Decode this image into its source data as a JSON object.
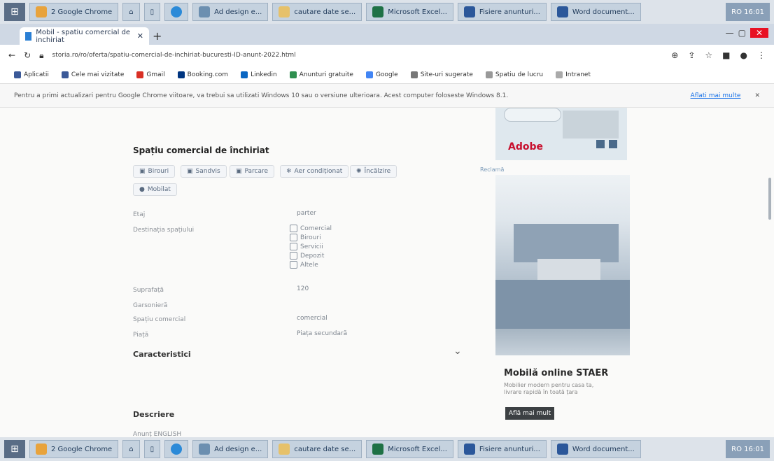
{
  "taskbar_top": {
    "start_icon": "windows-icon",
    "buttons": [
      {
        "label": "2 Google Chrome",
        "icon": "chrome-icon"
      },
      {
        "label": "",
        "icon": "home-icon"
      },
      {
        "label": "",
        "icon": "file-icon"
      },
      {
        "label": "",
        "icon": "edge-icon"
      },
      {
        "label": "Ad design e...",
        "icon": "document-icon"
      },
      {
        "label": "cautare date se...",
        "icon": "folder-icon"
      },
      {
        "label": "Microsoft Excel...",
        "icon": "excel-icon"
      },
      {
        "label": "Fisiere anunturi...",
        "icon": "word-icon"
      },
      {
        "label": "Word document...",
        "icon": "word-icon"
      }
    ],
    "tray": "RO 16:01"
  },
  "tabs": [
    {
      "label": "Mobil - spatiu comercial de inchiriat"
    }
  ],
  "address": {
    "url": "storia.ro/ro/oferta/spatiu-comercial-de-inchiriat-bucuresti-ID-anunt-2022.html"
  },
  "bookmarks": [
    "Aplicatii",
    "Cele mai vizitate",
    "Gmail",
    "Booking.com",
    "Linkedin",
    "Anunturi gratuite",
    "Google",
    "Site-uri sugerate",
    "Spatiu de lucru",
    "Intranet"
  ],
  "infobar": {
    "text": "Pentru a primi actualizari pentru Google Chrome viitoare, va trebui sa utilizati Windows 10 sau o versiune ulterioara. Acest computer foloseste Windows 8.1.",
    "link": "Aflati mai multe"
  },
  "listing": {
    "title": "Spațiu comercial de închiriat",
    "chips": [
      "Birouri",
      "Sandvis",
      "Parcare",
      "Aer condiționat",
      "Încălzire",
      "Mobilat"
    ],
    "details": [
      {
        "label": "Etaj",
        "value": "parter"
      },
      {
        "label": "Destinația spațiului",
        "value": ""
      },
      {
        "label": "Suprafață",
        "value": "120"
      },
      {
        "label": "Garsonieră",
        "value": ""
      },
      {
        "label": "Spațiu comercial",
        "value": "comercial"
      },
      {
        "label": "Piață",
        "value": "Piața secundară"
      }
    ],
    "facilities": [
      "Comercial",
      "Birouri",
      "Servicii",
      "Depozit",
      "Altele"
    ],
    "section_facilities": "Caracteristici",
    "section_description": "Descriere",
    "description_start": "Anunț ENGLISH"
  },
  "ads": {
    "top_brand": "Adobe",
    "mid_label": "Reclamă",
    "bottom_title": "Mobilă online STAER",
    "bottom_sub": "Mobilier modern pentru casa ta, livrare rapidă în toată țara",
    "bottom_button": "Află mai mult"
  },
  "colors": {
    "taskbar": "#dde3ea",
    "accent_blue": "#1a73e8",
    "adobe_red": "#c8102e"
  }
}
